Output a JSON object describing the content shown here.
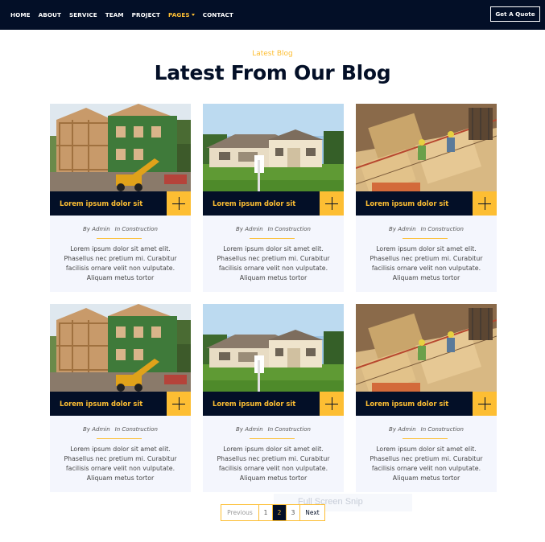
{
  "nav": {
    "items": [
      "HOME",
      "ABOUT",
      "SERVICE",
      "TEAM",
      "PROJECT",
      "PAGES",
      "CONTACT"
    ],
    "active_index": 5,
    "quote_label": "Get A Quote"
  },
  "header": {
    "subtitle": "Latest Blog",
    "title": "Latest From Our Blog"
  },
  "cards": [
    {
      "title": "Lorem ipsum dolor sit",
      "image": "house-construction-frame",
      "author": "By Admin",
      "category": "In Construction",
      "text": "Lorem ipsum dolor sit amet elit. Phasellus nec pretium mi. Curabitur facilisis ornare velit non vulputate. Aliquam metus tortor"
    },
    {
      "title": "Lorem ipsum dolor sit",
      "image": "finished-house",
      "author": "By Admin",
      "category": "In Construction",
      "text": "Lorem ipsum dolor sit amet elit. Phasellus nec pretium mi. Curabitur facilisis ornare velit non vulputate. Aliquam metus tortor"
    },
    {
      "title": "Lorem ipsum dolor sit",
      "image": "construction-workers-site",
      "author": "By Admin",
      "category": "In Construction",
      "text": "Lorem ipsum dolor sit amet elit. Phasellus nec pretium mi. Curabitur facilisis ornare velit non vulputate. Aliquam metus tortor"
    },
    {
      "title": "Lorem ipsum dolor sit",
      "image": "house-construction-frame",
      "author": "By Admin",
      "category": "In Construction",
      "text": "Lorem ipsum dolor sit amet elit. Phasellus nec pretium mi. Curabitur facilisis ornare velit non vulputate. Aliquam metus tortor"
    },
    {
      "title": "Lorem ipsum dolor sit",
      "image": "finished-house",
      "author": "By Admin",
      "category": "In Construction",
      "text": "Lorem ipsum dolor sit amet elit. Phasellus nec pretium mi. Curabitur facilisis ornare velit non vulputate. Aliquam metus tortor"
    },
    {
      "title": "Lorem ipsum dolor sit",
      "image": "construction-workers-site",
      "author": "By Admin",
      "category": "In Construction",
      "text": "Lorem ipsum dolor sit amet elit. Phasellus nec pretium mi. Curabitur facilisis ornare velit non vulputate. Aliquam metus tortor"
    }
  ],
  "pagination": {
    "prev": "Previous",
    "pages": [
      "1",
      "2",
      "3"
    ],
    "current": "2",
    "next": "Next"
  },
  "overlay": {
    "text": "Full Screen Snip"
  },
  "colors": {
    "navy": "#030f27",
    "accent": "#fdbe33",
    "card_bg": "#f4f6fd"
  }
}
